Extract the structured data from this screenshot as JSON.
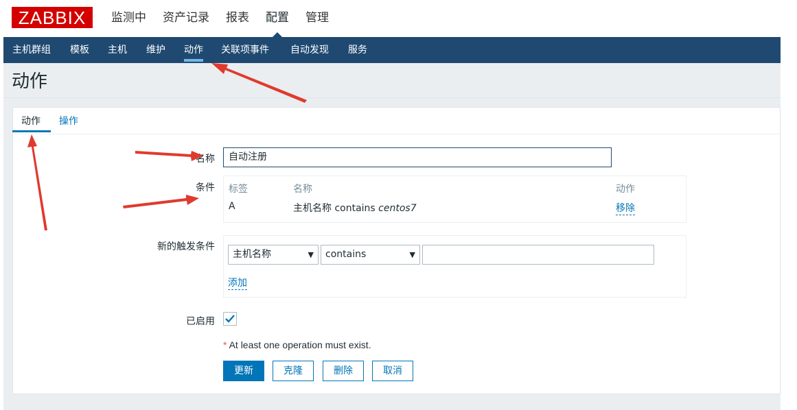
{
  "logo_text": "ZABBIX",
  "main_menu": [
    "监测中",
    "资产记录",
    "报表",
    "配置",
    "管理"
  ],
  "sub_menu": [
    "主机群组",
    "模板",
    "主机",
    "维护",
    "动作",
    "关联项事件",
    "自动发现",
    "服务"
  ],
  "page_title": "动作",
  "tabs": [
    "动作",
    "操作"
  ],
  "form": {
    "name_label": "名称",
    "name_value": "自动注册",
    "conditions_label": "条件",
    "conditions": {
      "headers": [
        "标签",
        "名称",
        "动作"
      ],
      "rows": [
        {
          "label": "A",
          "name_prefix": "主机名称 contains ",
          "name_value": "centos7",
          "action": "移除"
        }
      ]
    },
    "new_condition_label": "新的触发条件",
    "condition_type": "主机名称",
    "operator": "contains",
    "add_link": "添加",
    "enabled_label": "已启用",
    "enabled": true,
    "note_star": "*",
    "note": "At least one operation must exist.",
    "buttons": [
      "更新",
      "克隆",
      "删除",
      "取消"
    ]
  },
  "colors": {
    "brand_red": "#d40000",
    "nav_blue": "#1f4971",
    "accent_blue": "#0275b8",
    "annotation_red": "#e03a2e"
  }
}
